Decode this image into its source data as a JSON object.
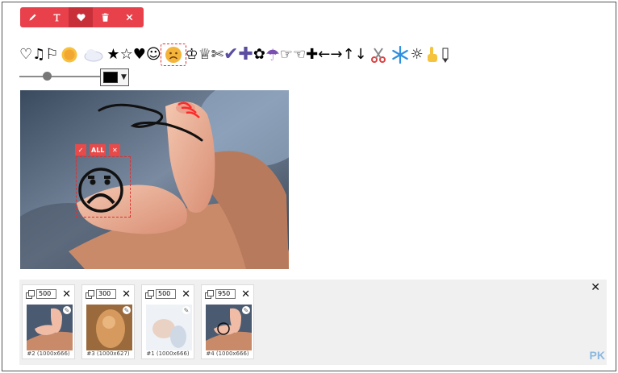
{
  "toolbar": {
    "tools": [
      {
        "name": "pencil-icon",
        "active": false
      },
      {
        "name": "text-icon",
        "active": false
      },
      {
        "name": "heart-icon",
        "active": true
      },
      {
        "name": "trash-icon",
        "active": false
      },
      {
        "name": "close-icon",
        "active": false
      }
    ]
  },
  "stickers": [
    "♡",
    "♫",
    "⚐",
    "sun",
    "cloud",
    "★",
    "☆",
    "♥",
    "☺",
    "frown",
    "♔",
    "♕",
    "✄",
    "✔",
    "✚",
    "✿",
    "☂",
    "☞",
    "☜",
    "✚",
    "←",
    "→",
    "↑",
    "↓",
    "scissors",
    "snowflake",
    "☼",
    "pointing-hand",
    "pencil"
  ],
  "slider": {
    "value": 0.3
  },
  "color": {
    "value": "#000000"
  },
  "selection": {
    "confirm_label": "✓",
    "all_label": "ALL",
    "close_label": "✕"
  },
  "tray": {
    "close_label": "✕",
    "cards": [
      {
        "size": "500",
        "caption": "#2 (1000x666)",
        "remove": "✕"
      },
      {
        "size": "300",
        "caption": "#3 (1000x627)",
        "remove": "✕"
      },
      {
        "size": "500",
        "caption": "#1 (1000x666)",
        "remove": "✕"
      },
      {
        "size": "950",
        "caption": "#4 (1000x666)",
        "remove": "✕"
      }
    ]
  },
  "watermark": "PK"
}
